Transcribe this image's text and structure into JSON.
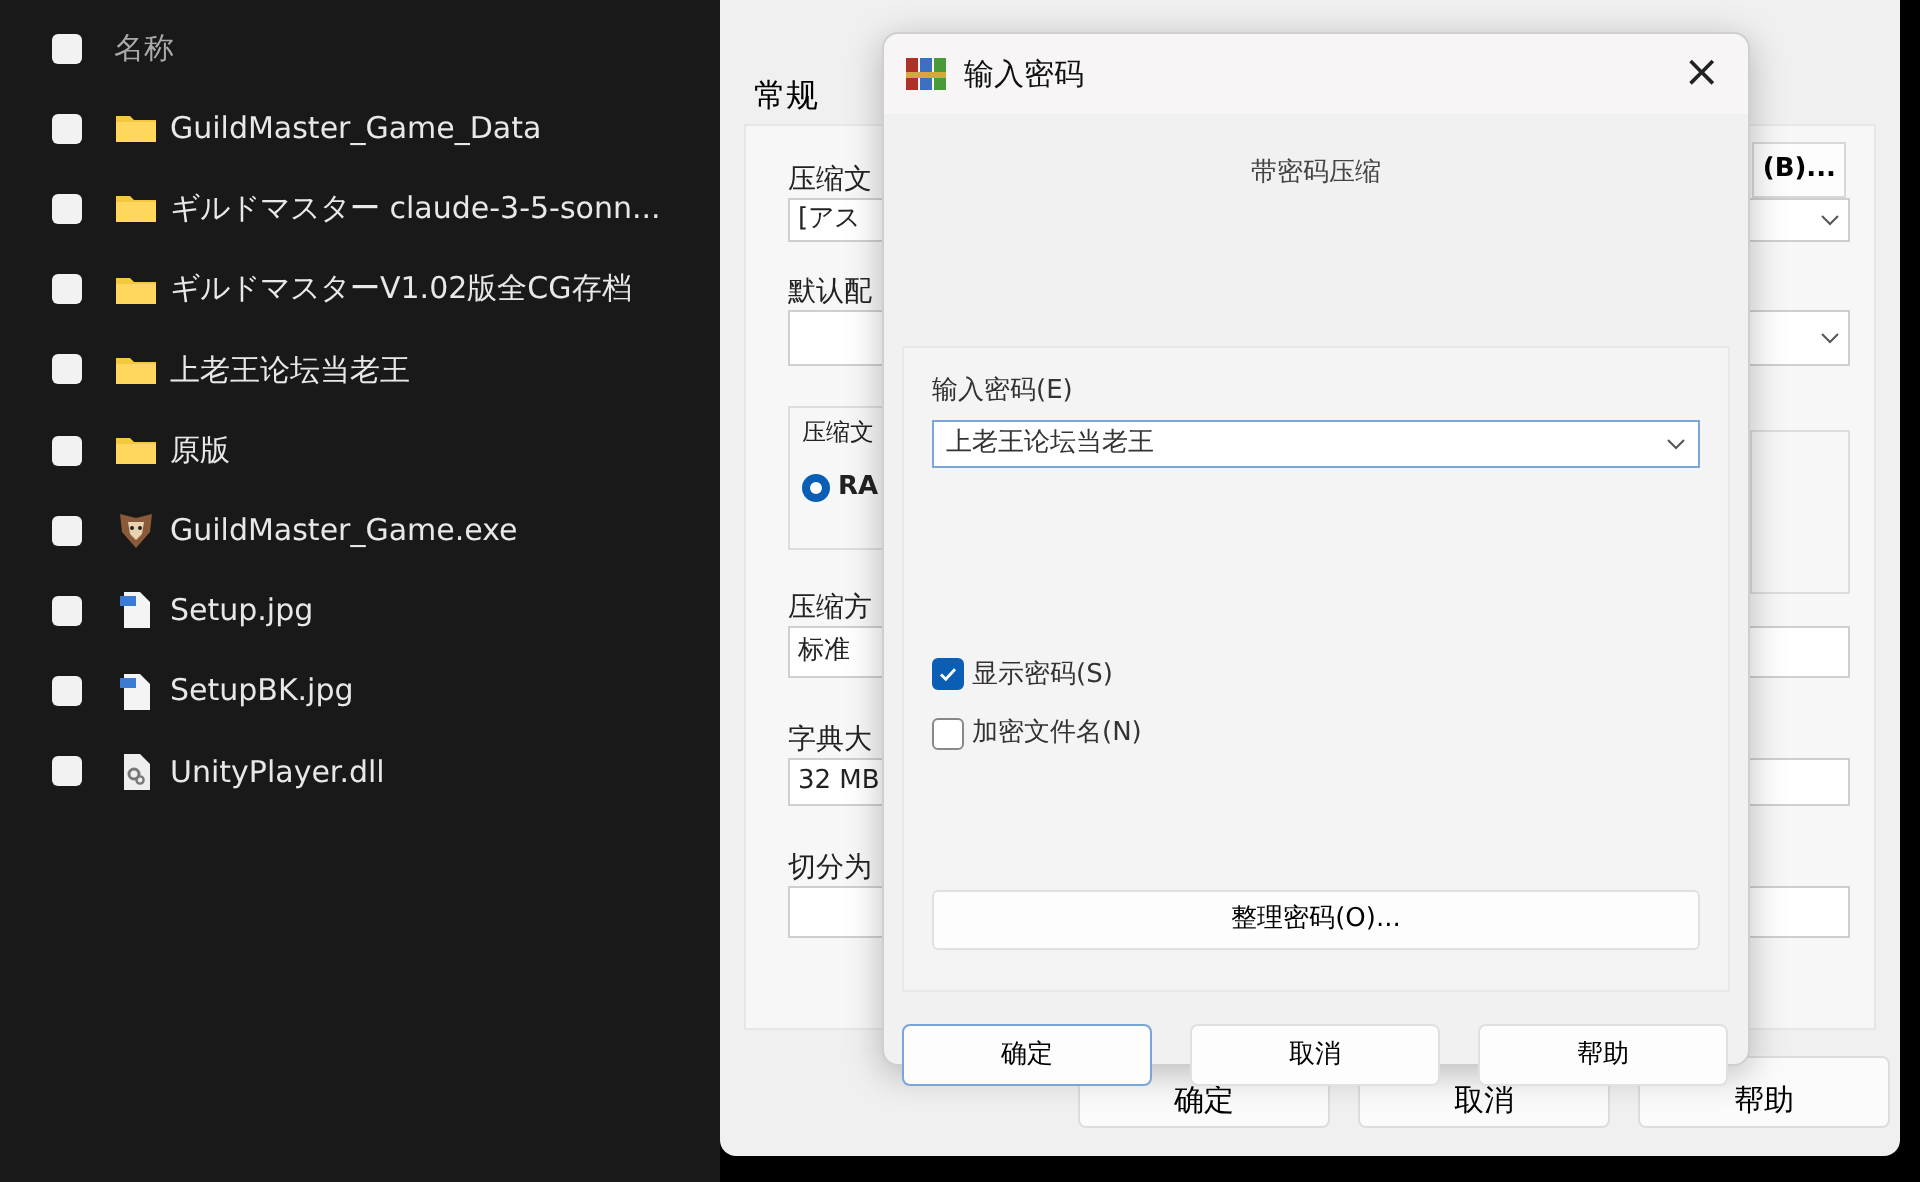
{
  "file_list": {
    "header": {
      "label": "名称",
      "checked": false
    },
    "items": [
      {
        "name": "GuildMaster_Game_Data",
        "kind": "folder",
        "checked": false
      },
      {
        "name": "ギルドマスター claude-3-5-sonn...",
        "kind": "folder",
        "checked": false
      },
      {
        "name": "ギルドマスターV1.02版全CG存档",
        "kind": "folder",
        "checked": false
      },
      {
        "name": "上老王论坛当老王",
        "kind": "folder",
        "checked": false
      },
      {
        "name": "原版",
        "kind": "folder",
        "checked": false
      },
      {
        "name": "GuildMaster_Game.exe",
        "kind": "exe",
        "checked": false
      },
      {
        "name": "Setup.jpg",
        "kind": "image",
        "checked": false
      },
      {
        "name": "SetupBK.jpg",
        "kind": "image",
        "checked": false
      },
      {
        "name": "UnityPlayer.dll",
        "kind": "dll",
        "checked": false
      }
    ]
  },
  "archive_window": {
    "tabs": [
      {
        "label": "常规",
        "selected": true
      }
    ],
    "browse_button": "(B)...",
    "archive_name": {
      "label": "压缩文",
      "value": "[アス"
    },
    "profile": {
      "label": "默认配"
    },
    "format_group": {
      "label": "压缩文",
      "options": [
        {
          "label": "RA",
          "selected": true
        }
      ]
    },
    "method": {
      "label": "压缩方",
      "value": "标准"
    },
    "dictionary": {
      "label": "字典大",
      "value": "32 MB"
    },
    "split": {
      "label": "切分为"
    },
    "buttons": [
      "确定",
      "取消",
      "帮助"
    ]
  },
  "dialog": {
    "title": "输入密码",
    "close": "×",
    "subtitle": "带密码压缩",
    "password": {
      "label": "输入密码(E)",
      "value": "上老王论坛当老王"
    },
    "options": [
      {
        "label": "显示密码(S)",
        "checked": true
      },
      {
        "label": "加密文件名(N)",
        "checked": false
      }
    ],
    "organize_button": "整理密码(O)...",
    "buttons": [
      {
        "label": "确定",
        "default": true
      },
      {
        "label": "取消",
        "default": false
      },
      {
        "label": "帮助",
        "default": false
      }
    ]
  }
}
